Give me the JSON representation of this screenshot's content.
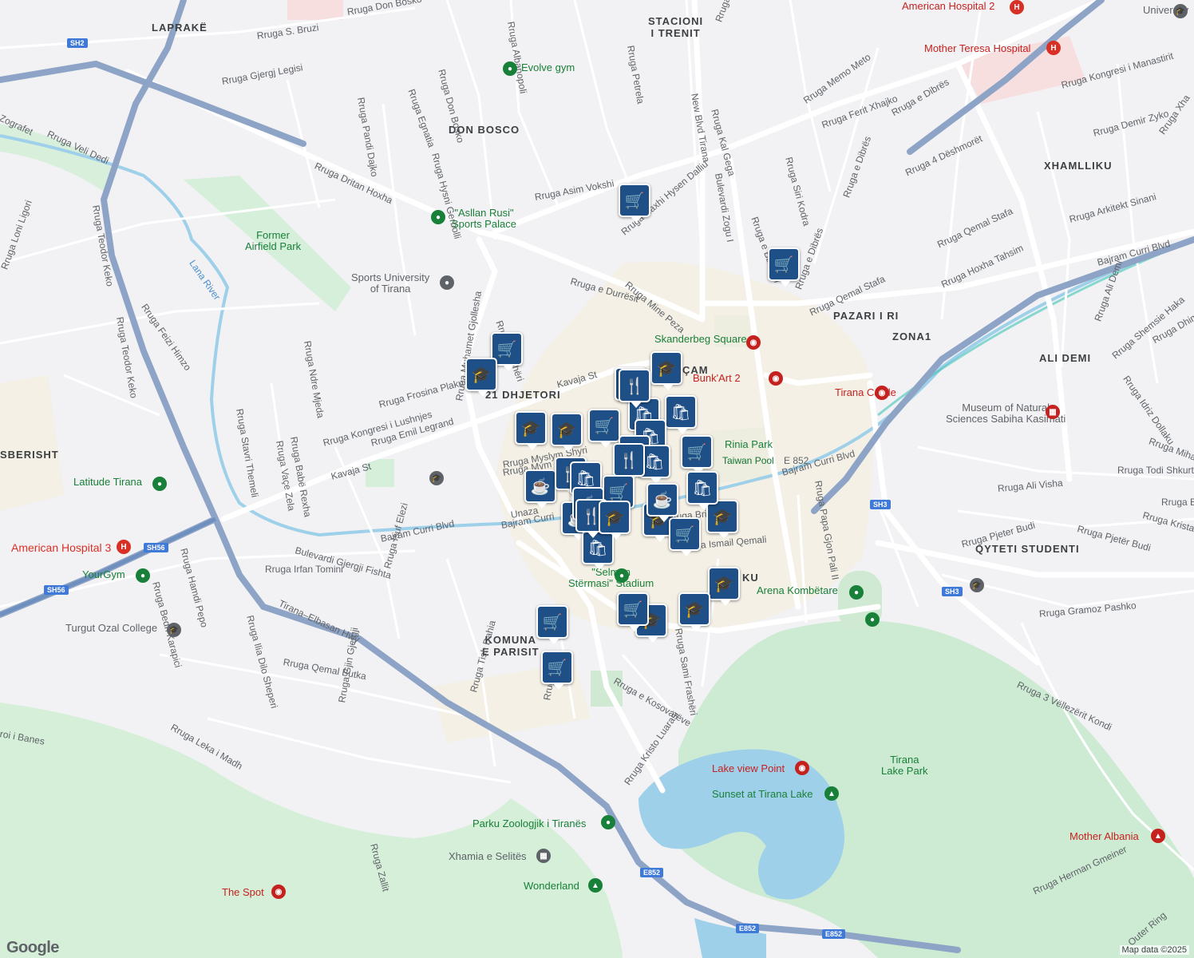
{
  "map": {
    "attribution": "Map data ©2025",
    "logo": "Google",
    "colors": {
      "background": "#f2f2f4",
      "road": "#ffffff",
      "highway": "#8ea4c6",
      "park": "#cdebd3",
      "water": "#9fd0ea",
      "marker": "#1e4f86",
      "poi_green": "#188038",
      "poi_pink": "#c5221f"
    },
    "area_labels": [
      {
        "text": "LAPRAKË"
      },
      {
        "text": "STACIONI\nI TRENIT"
      },
      {
        "text": "DON BOSCO"
      },
      {
        "text": "XHAMLLIKU"
      },
      {
        "text": "PAZARI I RI"
      },
      {
        "text": "ZONA1"
      },
      {
        "text": "ALI DEMI"
      },
      {
        "text": "21 DHJETORI"
      },
      {
        "text": "ÇAM"
      },
      {
        "text": "SBERISHT"
      },
      {
        "text": "QYTETI STUDENTI"
      },
      {
        "text": "KOMUNA\nE PARISIT"
      },
      {
        "text": "KU"
      }
    ],
    "street_labels": [
      "Rruga Don Bosko",
      "Rruga S. Bruzi",
      "Rruga Albanopoli",
      "Rruga Petrela",
      "Rruga Siri Kodra",
      "Rruga Memo Meto",
      "Rruga Ferit Xhajko",
      "Rruga e Dibrës",
      "Rruga Kongresi i Manastirit",
      "Rruga Demir Zyko",
      "Rruga Xha",
      "Zografet",
      "Rruga Veli Dedi",
      "Rruga Gjergj Legisi",
      "Rruga Pandi Dajko",
      "Rruga Egnatia",
      "Rruga Don Bosko",
      "Rruga Kal Gega",
      "New Blvd Tirana",
      "Rruga Siri Kodra",
      "Rruga e Dibrës",
      "Rruga Hysni Gerbolli",
      "Rruga Dritan Hoxha",
      "Rruga Asim Vokshi",
      "Rruga Haxhi Hysen Dalliu",
      "Bulevardi Zogu I",
      "Rruga e Bardhyl",
      "Rruga 4 Dëshmorët",
      "Rruga Arkitekt Sinani",
      "Rruga Qemal Stafa",
      "Rruga Hoxha Tahsim",
      "Rruga Qemal Stafa",
      "Rruga e Dibrës",
      "Bajram Curri Blvd",
      "Rruga Teodor Keko",
      "Rruga Loni Ligori",
      "Rruga Teodor Keko",
      "Rruga Feizi Himzo",
      "Rruga Ndre Mjeda",
      "Rruga Muhamet Gjollesha",
      "Rruga e Durrësit",
      "Rruga Mine Peza",
      "Rruga Frashëri",
      "Rruga Frosina Plaku",
      "Kavaja St",
      "Rruga Kongresi i Lushnjes",
      "Rruga Emil Legrand",
      "Rruga Babë Rexha",
      "Rruga Vaçe Zela",
      "Rruga Stavri Themeli",
      "Kavaja St",
      "Rruga Ali Demi",
      "Rruga Shemsie Haka",
      "Rruga Dhim",
      "Rruga Idriz Dollaku",
      "Rruga Mihal Gram",
      "Rruga Todi Shkurti",
      "Rruga Ali Visha",
      "Rruga Es",
      "Rruga Kristaq",
      "Rruga Pjeter Budi",
      "Rruga Pjetër Budi",
      "Rruga Papa Gjon Pali II",
      "Bajram Curri Blvd",
      "E 852",
      "Rruga Gramoz Pashko",
      "Unaza",
      "Bajram Curri",
      "Bulevardi Gjergji Fishta",
      "Bajram Curri Blvd",
      "Rruga Irfan Tomini",
      "Rruga Isuf Elezi",
      "Rruga Ismail Qemali",
      "Rruga Brigadave",
      "Rruga Hamdi Pepo",
      "Rruga Bedri Karapici",
      "Rruga Ilia Dilo Sheperi",
      "Rruga Qemal Butka",
      "Tirana–Elbasan Hwy",
      "Rruga Sami Frashëri",
      "Rruga Tish Dahia",
      "Rruga Blla",
      "Rruga e Kosovarëve",
      "Rruga Leka i Madh",
      "Rruga Gjin Gjergji",
      "roi i Banes",
      "Rruga Kristo Luarasi",
      "Rruga 3 Vëllezërit Kondi",
      "Rruga Herman Gmeiner",
      "Outer Ring",
      "Rruga Zallit",
      "Rruga Mym",
      "Rruga Myslym Shyri"
    ],
    "pois": [
      {
        "text": "American Hospital 2",
        "kind": "hospital"
      },
      {
        "text": "Mother Teresa Hospital",
        "kind": "hospital"
      },
      {
        "text": "University",
        "kind": "education"
      },
      {
        "text": "Evolve gym",
        "kind": "gym"
      },
      {
        "text": "\"Asllan Rusi\"\nSports Palace",
        "kind": "gym"
      },
      {
        "text": "Former\nAirfield Park",
        "kind": "park"
      },
      {
        "text": "Sports University\nof Tirana",
        "kind": "education"
      },
      {
        "text": "Skanderbeg Square",
        "kind": "attraction"
      },
      {
        "text": "Bunk'Art 2",
        "kind": "attraction"
      },
      {
        "text": "Tirana Castle",
        "kind": "attraction"
      },
      {
        "text": "Museum of Natural\nSciences Sabiha Kasimati",
        "kind": "museum"
      },
      {
        "text": "Rinia Park",
        "kind": "park"
      },
      {
        "text": "Taiwan Pool",
        "kind": "water"
      },
      {
        "text": "Latitude Tirana",
        "kind": "gym"
      },
      {
        "text": "American Hospital 3",
        "kind": "hospital"
      },
      {
        "text": "YourGym",
        "kind": "gym"
      },
      {
        "text": "Turgut Ozal College",
        "kind": "education"
      },
      {
        "text": "\"Selman\nStërmasi\" Stadium",
        "kind": "stadium"
      },
      {
        "text": "Arena Kombëtare",
        "kind": "stadium"
      },
      {
        "text": "Lana River",
        "kind": "water"
      },
      {
        "text": "Lake view Point",
        "kind": "attraction"
      },
      {
        "text": "Tirana\nLake Park",
        "kind": "park"
      },
      {
        "text": "Sunset at Tirana Lake",
        "kind": "park"
      },
      {
        "text": "Parku Zoologjik i Tiranës",
        "kind": "zoo"
      },
      {
        "text": "Xhamia e Selitës",
        "kind": "religious"
      },
      {
        "text": "Wonderland",
        "kind": "park"
      },
      {
        "text": "The Spot",
        "kind": "attraction"
      },
      {
        "text": "Mother Albania",
        "kind": "attraction"
      }
    ],
    "road_shields": [
      "SH2",
      "SH56",
      "SH3",
      "SH3",
      "E852",
      "E852",
      "E852"
    ],
    "marker_icons": {
      "shopping_cart": "🛒",
      "school": "🎓",
      "restaurant": "🍴",
      "cafe": "☕",
      "shopping_bag": "🛍"
    },
    "markers": [
      {
        "icon": "shopping_cart"
      },
      {
        "icon": "shopping_cart"
      },
      {
        "icon": "shopping_cart"
      },
      {
        "icon": "school"
      },
      {
        "icon": "school"
      },
      {
        "icon": "restaurant"
      },
      {
        "icon": "shopping_bag"
      },
      {
        "icon": "shopping_bag"
      },
      {
        "icon": "school"
      },
      {
        "icon": "school"
      },
      {
        "icon": "shopping_cart"
      },
      {
        "icon": "shopping_bag"
      },
      {
        "icon": "cafe"
      },
      {
        "icon": "shopping_cart"
      },
      {
        "icon": "shopping_bag"
      },
      {
        "icon": "cafe"
      },
      {
        "icon": "restaurant"
      },
      {
        "icon": "cafe"
      },
      {
        "icon": "shopping_bag"
      },
      {
        "icon": "restaurant"
      },
      {
        "icon": "shopping_cart"
      },
      {
        "icon": "cafe"
      },
      {
        "icon": "shopping_bag"
      },
      {
        "icon": "cafe"
      },
      {
        "icon": "restaurant"
      },
      {
        "icon": "school"
      },
      {
        "icon": "school"
      },
      {
        "icon": "shopping_cart"
      },
      {
        "icon": "school"
      },
      {
        "icon": "shopping_bag"
      },
      {
        "icon": "school"
      },
      {
        "icon": "shopping_cart"
      },
      {
        "icon": "school"
      },
      {
        "icon": "school"
      },
      {
        "icon": "shopping_cart"
      },
      {
        "icon": "shopping_cart"
      },
      {
        "icon": "restaurant"
      },
      {
        "icon": "cafe"
      }
    ]
  }
}
